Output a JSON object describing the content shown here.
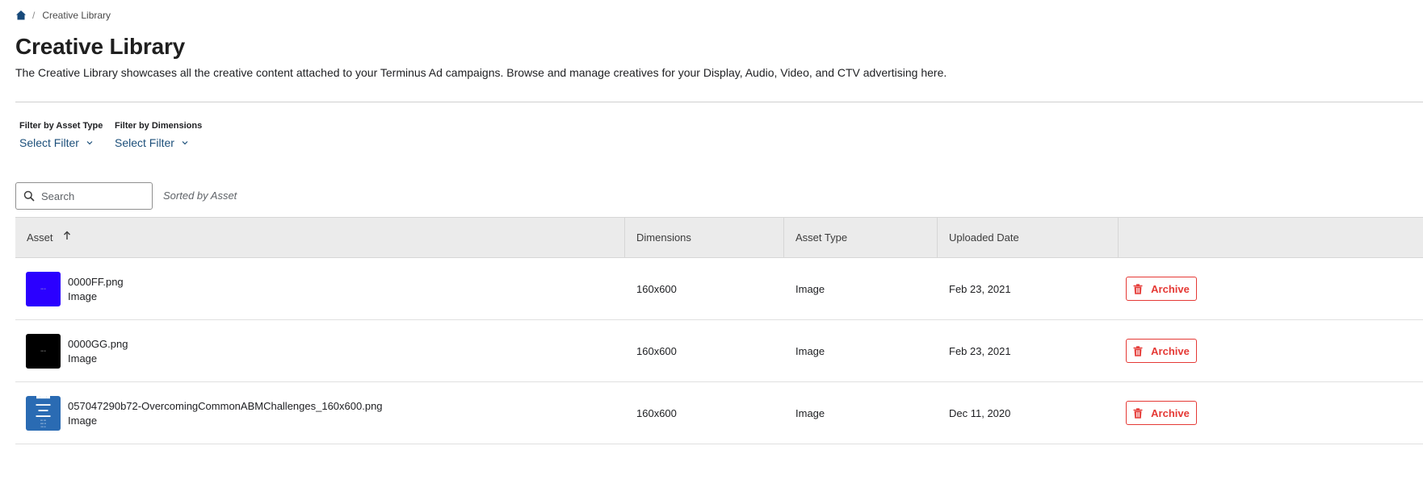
{
  "breadcrumb": {
    "home_icon": "home-icon",
    "current": "Creative Library"
  },
  "page": {
    "title": "Creative Library",
    "description": "The Creative Library showcases all the creative content attached to your Terminus Ad campaigns. Browse and manage creatives for your Display, Audio, Video, and CTV advertising here."
  },
  "filters": [
    {
      "label": "Filter by Asset Type",
      "value": "Select Filter"
    },
    {
      "label": "Filter by Dimensions",
      "value": "Select Filter"
    }
  ],
  "search": {
    "placeholder": "Search",
    "value": ""
  },
  "sort_status": "Sorted by Asset",
  "table": {
    "columns": [
      "Asset",
      "Dimensions",
      "Asset Type",
      "Uploaded Date",
      ""
    ],
    "sort_column": "Asset",
    "sort_direction": "ascending",
    "rows": [
      {
        "name": "0000FF.png",
        "kind": "Image",
        "dimensions": "160x600",
        "asset_type": "Image",
        "uploaded": "Feb 23, 2021",
        "action": "Archive",
        "thumb_color": "#2b00ff"
      },
      {
        "name": "0000GG.png",
        "kind": "Image",
        "dimensions": "160x600",
        "asset_type": "Image",
        "uploaded": "Feb 23, 2021",
        "action": "Archive",
        "thumb_color": "#000000"
      },
      {
        "name": "057047290b72-OvercomingCommonABMChallenges_160x600.png",
        "kind": "Image",
        "dimensions": "160x600",
        "asset_type": "Image",
        "uploaded": "Dec 11, 2020",
        "action": "Archive",
        "thumb_color": "#2a6bb3"
      }
    ]
  },
  "colors": {
    "accent_link": "#1c4f7a",
    "danger": "#e53935",
    "header_bg": "#ebebeb",
    "home_icon": "#17497a"
  }
}
